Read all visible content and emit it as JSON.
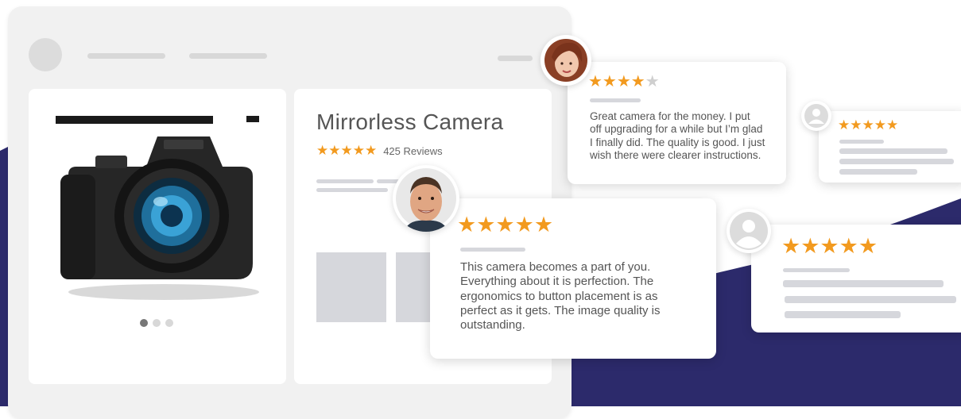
{
  "colors": {
    "navy": "#2c2a6b",
    "star": "#f29a1f",
    "window": "#f1f1f1",
    "placeholder": "#d6d7dc"
  },
  "product": {
    "title": "Mirrorless Camera",
    "rating_stars": "★★★★★",
    "reviews_count": "425 Reviews",
    "image_icon": "camera-icon",
    "carousel": {
      "count": 3,
      "active": 0
    }
  },
  "reviews": [
    {
      "stars": "★★★★",
      "empty_stars": "★",
      "rating": 4,
      "avatar": "woman-photo",
      "lines": [
        "Great camera for the money. I put",
        "off upgrading for a while but I’m glad",
        "I finally did. The quality is good. I just",
        "wish there were clearer instructions."
      ]
    },
    {
      "stars": "★★★★★",
      "rating": 5,
      "avatar": "user-icon"
    },
    {
      "stars": "★★★★★",
      "rating": 5,
      "avatar": "man-photo",
      "lines": [
        "This camera becomes a part of you.",
        "Everything about it is perfection. The",
        "ergonomics to button placement is as",
        "perfect as it gets.  The image quality is",
        "outstanding."
      ]
    },
    {
      "stars": "★★★★★",
      "rating": 5,
      "avatar": "user-icon"
    }
  ]
}
